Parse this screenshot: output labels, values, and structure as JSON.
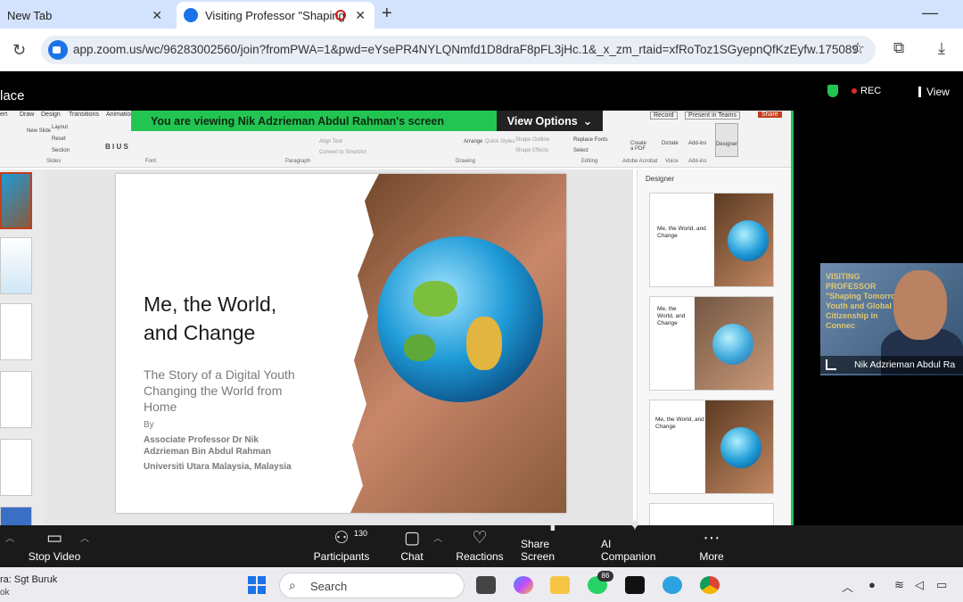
{
  "browser": {
    "tabs": [
      {
        "label": "New Tab",
        "close": "✕"
      },
      {
        "label": "Visiting Professor \"Shaping",
        "close": "✕"
      }
    ],
    "new_tab": "+",
    "minimize": "—",
    "url": "app.zoom.us/wc/96283002560/join?fromPWA=1&pwd=eYsePR4NYLQNmfd1D8draF8pFL3jHc.1&_x_zm_rtaid=xfRoToz1SGyepnQfKzEyfw.175089...",
    "icons": {
      "reload": "reload-icon",
      "star": "star-icon",
      "extensions": "puzzle-icon",
      "download": "download-icon"
    }
  },
  "meeting": {
    "title": "lace",
    "rec": "REC",
    "view": "View",
    "viewing_banner": "You are viewing  Nik Adzrieman Abdul Rahman's screen",
    "view_options": "View Options",
    "participant_name": "Nik Adzrieman Abdul Ra",
    "bg_text": "VISITING PROFESSOR \"Shaping Tomorrow: Youth and Global Citizenship in Connec"
  },
  "ppt": {
    "tabs": [
      "ert",
      "Draw",
      "Design",
      "Transitions",
      "Animation"
    ],
    "right_buttons": [
      "Record",
      "Present in Teams",
      "Share"
    ],
    "groups": [
      "Slides",
      "Font",
      "Paragraph",
      "Drawing",
      "Editing",
      "Adobe Acrobat",
      "Voice",
      "Add-ins"
    ],
    "items": [
      "New Slide",
      "Layout",
      "Reset",
      "Section",
      "Arrange",
      "Quick Styles",
      "Shape Outline",
      "Shape Effects",
      "Replace Fonts",
      "Select",
      "Create a PDF",
      "Dictate",
      "Add-ins",
      "Designer",
      "Align Text",
      "Convert to SmartArt"
    ],
    "designer_title": "Designer",
    "slide": {
      "title_line1": "Me, the World,",
      "title_line2": "and Change",
      "subtitle": "The Story of a Digital Youth Changing the World from Home",
      "by": "By",
      "author": "Associate Professor Dr Nik Adzrieman Bin Abdul Rahman",
      "university": "Universiti Utara Malaysia, Malaysia"
    },
    "designer_cards": [
      "Me, the World, and Change",
      "Me, the World, and Change",
      "Me, the World, and Change"
    ]
  },
  "controls": {
    "stop_video": "Stop Video",
    "participants": "Participants",
    "participant_count": "130",
    "chat": "Chat",
    "reactions": "Reactions",
    "share_screen": "Share Screen",
    "ai_companion": "AI Companion",
    "more": "More"
  },
  "taskbar": {
    "weather_line1": "ra: Sgt Buruk",
    "weather_line2": "ok",
    "search_placeholder": "Search",
    "whatsapp_badge": "86"
  },
  "colors": {
    "zoom_green": "#23c552",
    "accent_blue": "#1a73e8",
    "rec_red": "#e02828"
  }
}
